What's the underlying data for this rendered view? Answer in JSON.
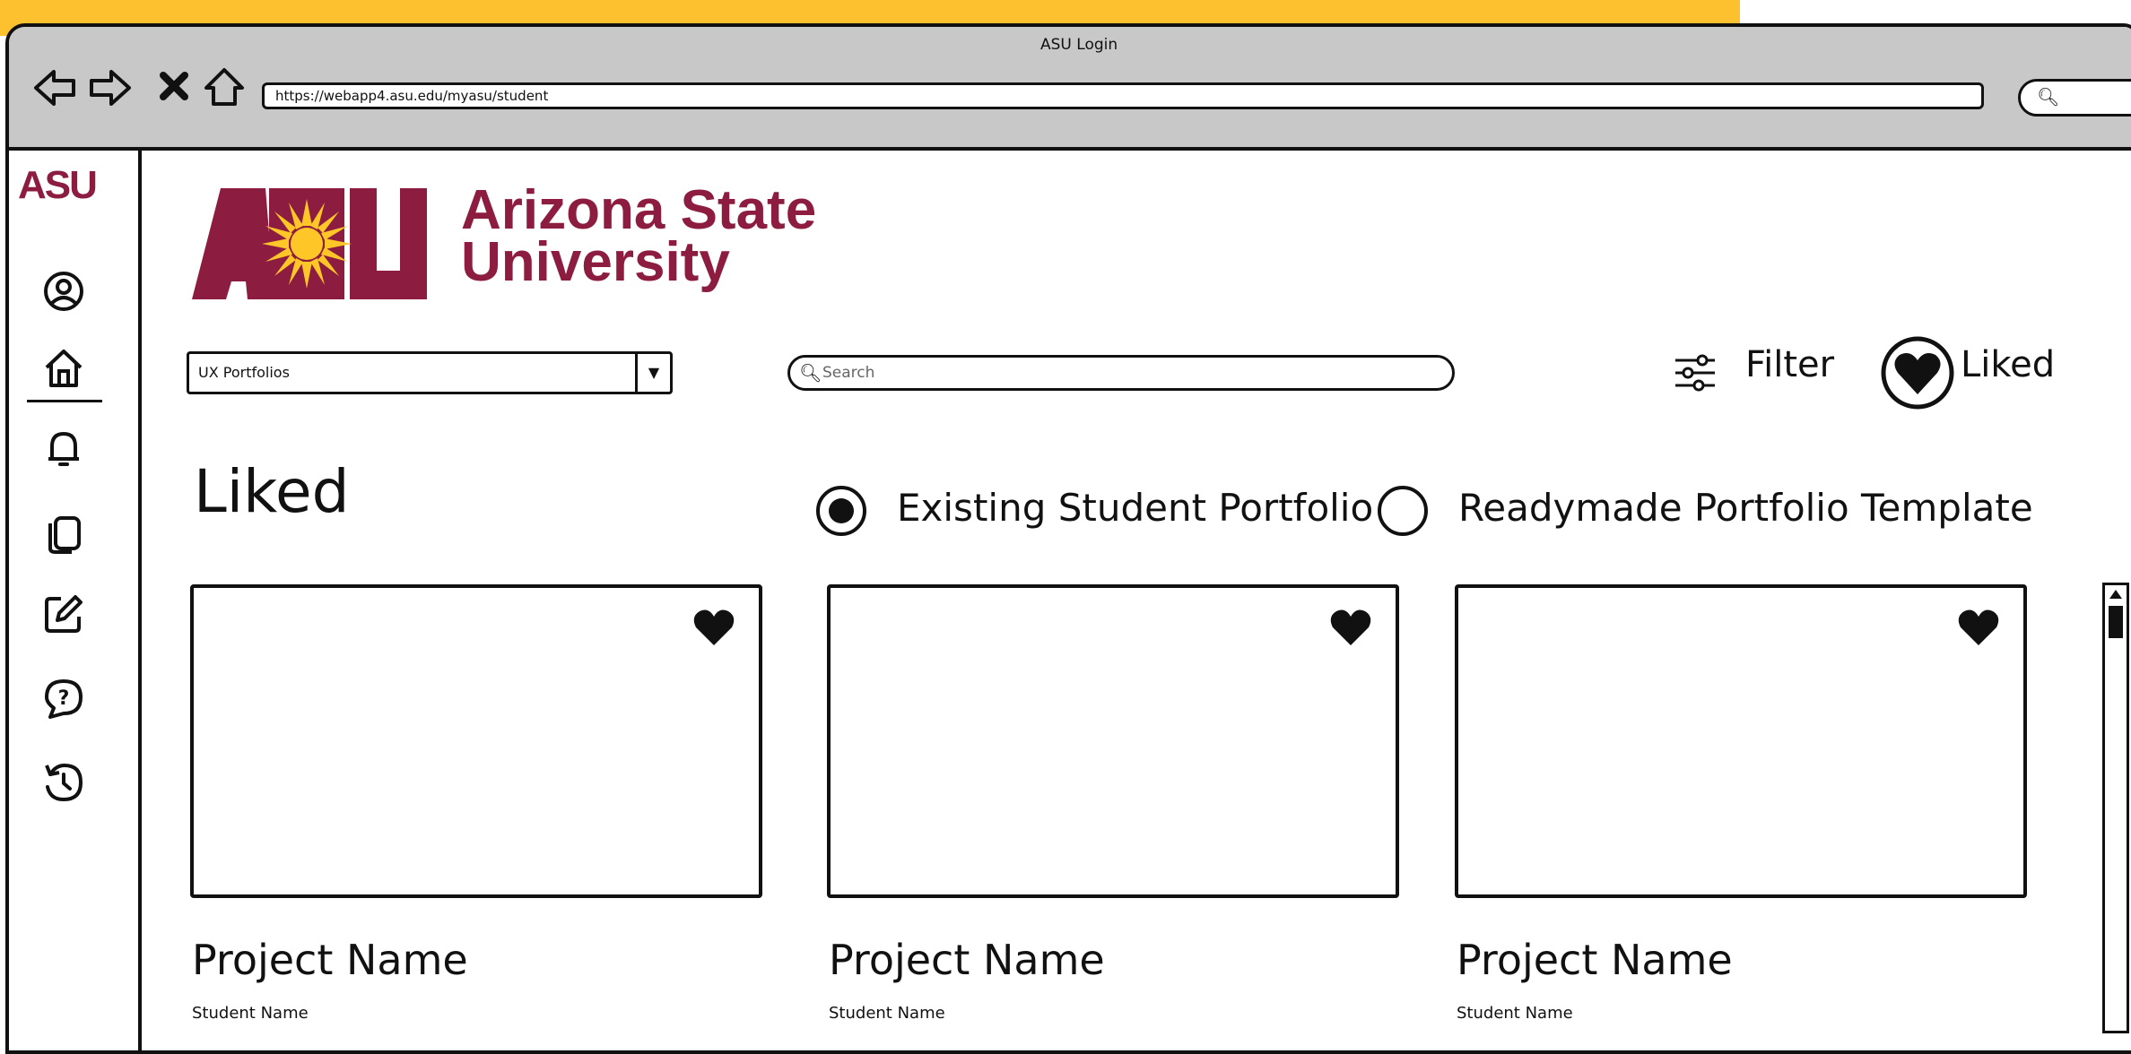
{
  "window": {
    "title": "ASU Login",
    "url": "https://webapp4.asu.edu/myasu/student"
  },
  "sidebar": {
    "logo": "ASU"
  },
  "brand": {
    "name_line1": "Arizona State",
    "name_line2": "University"
  },
  "toolbar": {
    "dropdown_value": "UX Portfolios",
    "search_placeholder": "Search",
    "filter_label": "Filter",
    "liked_label": "Liked"
  },
  "page": {
    "title": "Liked",
    "radio_options": [
      {
        "label": "Existing Student Portfolio",
        "selected": true
      },
      {
        "label": "Readymade Portfolio Template",
        "selected": false
      }
    ]
  },
  "cards": [
    {
      "project": "Project Name",
      "student": "Student Name"
    },
    {
      "project": "Project Name",
      "student": "Student Name"
    },
    {
      "project": "Project Name",
      "student": "Student Name"
    }
  ],
  "colors": {
    "asu_maroon": "#8c1d40",
    "asu_gold": "#ffc627",
    "titlebar": "#c8c8c8"
  }
}
